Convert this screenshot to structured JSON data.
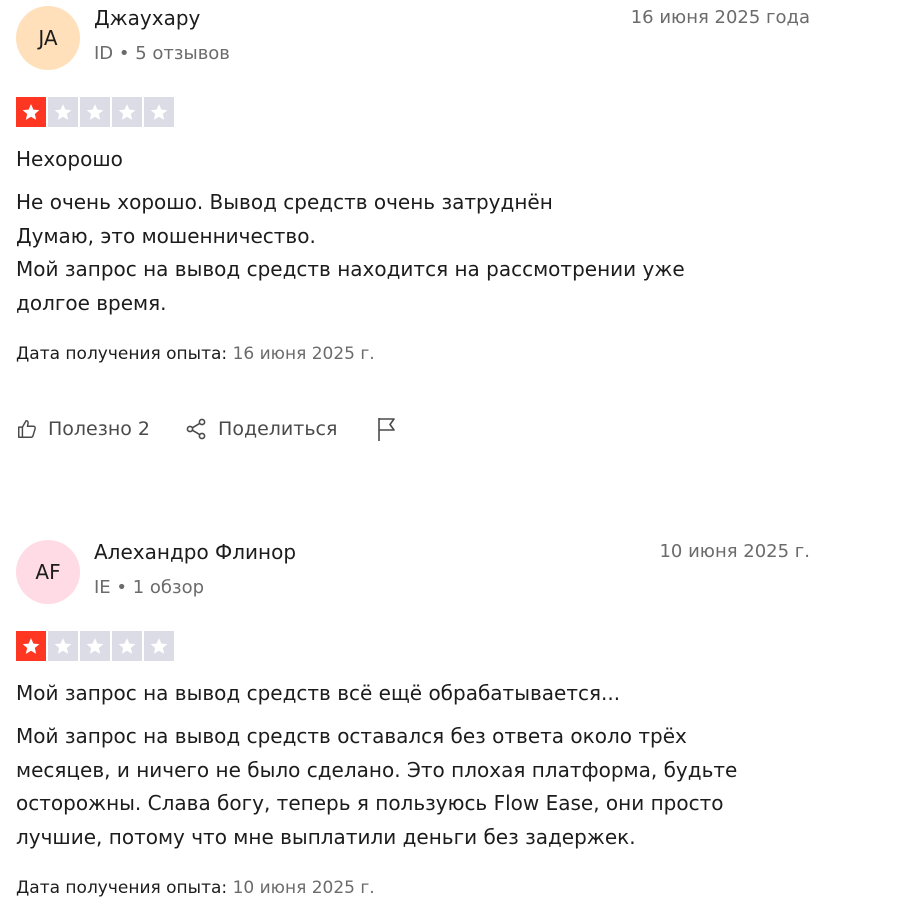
{
  "reviews": [
    {
      "initials": "JA",
      "avatar_color": "#ffe0bb",
      "author": "Джаухару",
      "country": "ID",
      "review_count": "5 отзывов",
      "date": "16 июня 2025 года",
      "rating": 1,
      "rating_max": 5,
      "title": "Нехорошо",
      "body_lines": [
        "Не очень хорошо. Вывод средств очень затруднён",
        "Думаю, это мошенничество.",
        "Мой запрос на вывод средств находится на рассмотрении уже",
        "долгое время."
      ],
      "experience_label": "Дата получения опыта:",
      "experience_date": "16 июня 2025 г.",
      "useful_label": "Полезно 2",
      "share_label": "Поделиться"
    },
    {
      "initials": "AF",
      "avatar_color": "#ffdbe5",
      "author": "Алехандро Флинор",
      "country": "IE",
      "review_count": "1 обзор",
      "date": "10 июня 2025 г.",
      "rating": 1,
      "rating_max": 5,
      "title": "Мой запрос на вывод средств всё ещё обрабатывается...",
      "body_lines": [
        "Мой запрос на вывод средств оставался без ответа около трёх",
        "месяцев, и ничего не было сделано. Это плохая платформа, будьте",
        "осторожны. Слава богу, теперь я пользуюсь Flow Ease, они просто",
        "лучшие, потому что мне выплатили деньги без задержек."
      ],
      "experience_label": "Дата получения опыта:",
      "experience_date": "10 июня 2025 г."
    }
  ],
  "separator": " • ",
  "colors": {
    "star_filled": "#ff3722",
    "star_empty": "#dcdce6",
    "muted_text": "#6b6b6b"
  },
  "icons": {
    "useful": "thumbs-up-icon",
    "share": "share-icon",
    "report": "flag-icon",
    "star": "star-icon"
  }
}
